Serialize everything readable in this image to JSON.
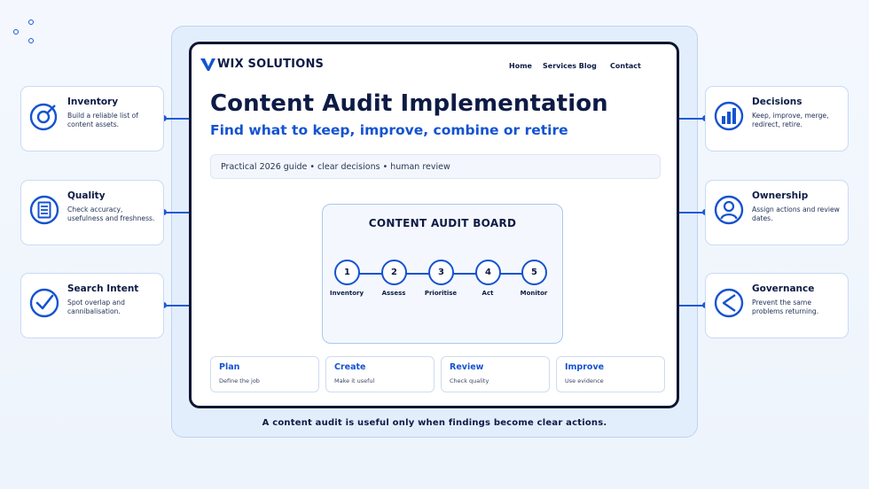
{
  "brand": {
    "name": "WIX SOLUTIONS"
  },
  "nav": {
    "links": [
      "Home",
      "Services Blog",
      "Contact"
    ]
  },
  "hero": {
    "title": "Content Audit Implementation",
    "subtitle": "Find what to keep, improve, combine or retire",
    "guide": "Practical 2026 guide • clear decisions • human review"
  },
  "board": {
    "title": "CONTENT AUDIT BOARD",
    "steps": [
      {
        "number": "1",
        "label": "Inventory"
      },
      {
        "number": "2",
        "label": "Assess"
      },
      {
        "number": "3",
        "label": "Prioritise"
      },
      {
        "number": "4",
        "label": "Act"
      },
      {
        "number": "5",
        "label": "Monitor"
      }
    ]
  },
  "mini_cards": [
    {
      "title": "Plan",
      "desc": "Define the job"
    },
    {
      "title": "Create",
      "desc": "Make it useful"
    },
    {
      "title": "Review",
      "desc": "Check quality"
    },
    {
      "title": "Improve",
      "desc": "Use evidence"
    }
  ],
  "left_cards": [
    {
      "title": "Inventory",
      "desc": "Build a reliable list of content assets.",
      "icon": "target-icon"
    },
    {
      "title": "Quality",
      "desc": "Check accuracy, usefulness and freshness.",
      "icon": "document-icon"
    },
    {
      "title": "Search Intent",
      "desc": "Spot overlap and cannibalisation.",
      "icon": "check-circle-icon"
    }
  ],
  "right_cards": [
    {
      "title": "Decisions",
      "desc": "Keep, improve, merge, redirect, retire.",
      "icon": "bar-chart-icon"
    },
    {
      "title": "Ownership",
      "desc": "Assign actions and review dates.",
      "icon": "user-icon"
    },
    {
      "title": "Governance",
      "desc": "Prevent the same problems returning.",
      "icon": "chevron-left-icon"
    }
  ],
  "caption": "A content audit is useful only when findings become clear actions.",
  "colors": {
    "accent": "#1553d1",
    "navy": "#0d1b45",
    "frame": "#e3eefc",
    "border": "#c9dbf3"
  }
}
